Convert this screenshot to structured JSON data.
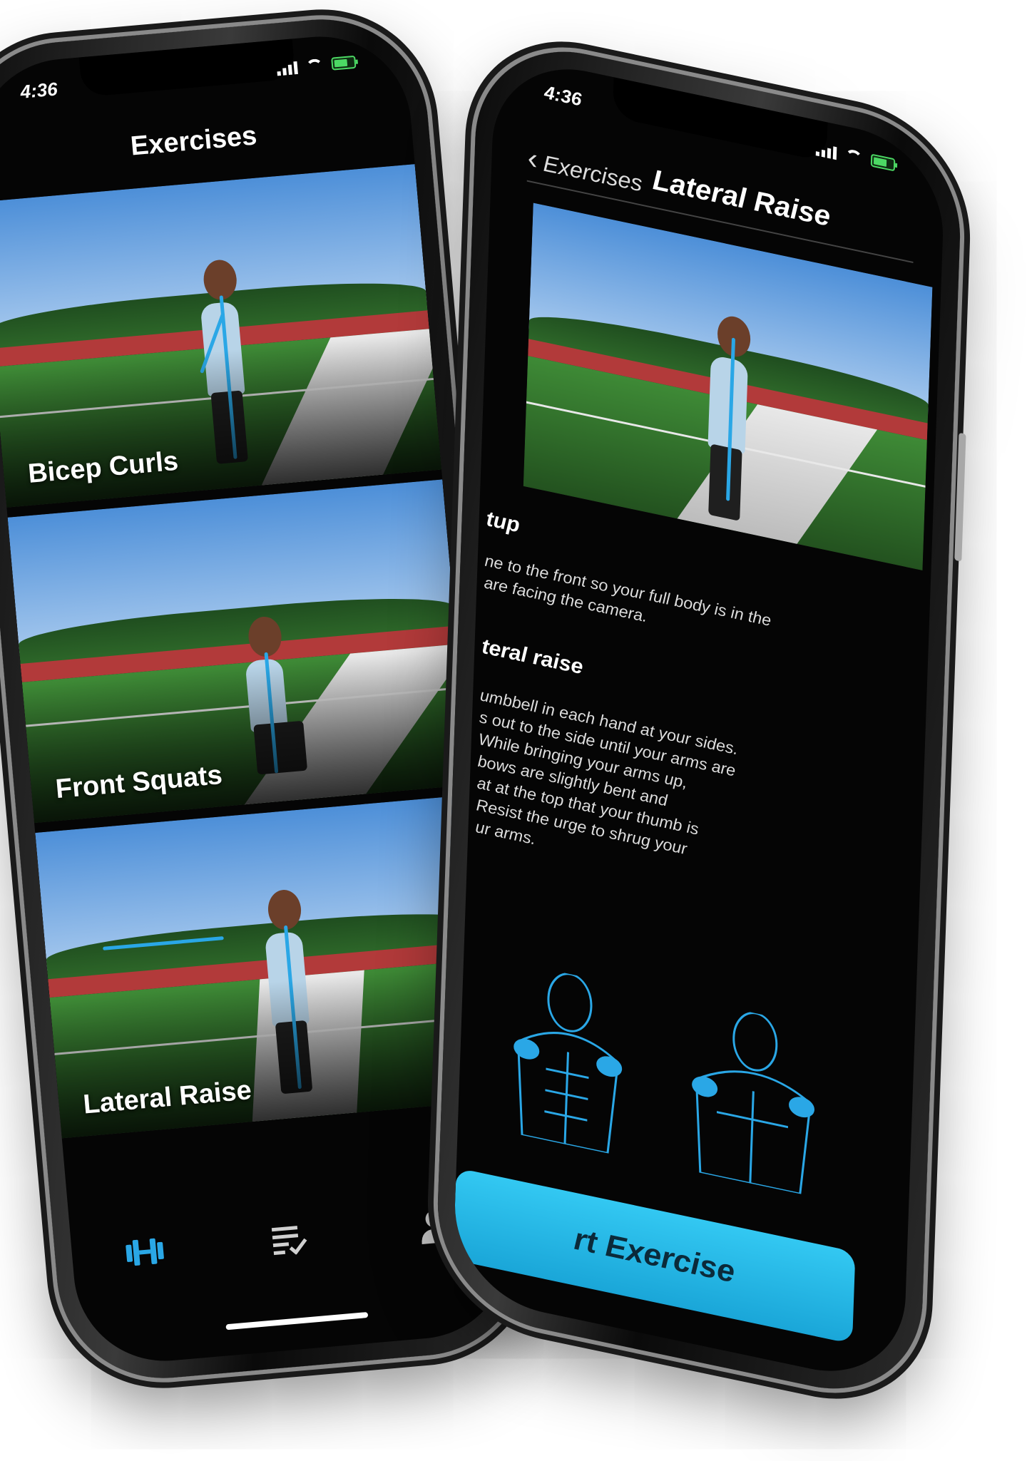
{
  "status": {
    "time": "4:36"
  },
  "left": {
    "title": "Exercises",
    "exercises": [
      {
        "name": "Bicep Curls"
      },
      {
        "name": "Front Squats"
      },
      {
        "name": "Lateral Raise"
      }
    ],
    "tabs": [
      "dumbbell-icon",
      "checklist-icon",
      "profile-icon"
    ],
    "accent": "#2aa7e6"
  },
  "right": {
    "back_label": "Exercises",
    "title": "Lateral Raise",
    "setup_heading": "tup",
    "setup_text_1": "ne to the front so your full body is in the",
    "setup_text_2": "are facing the camera.",
    "how_heading": "teral raise",
    "how_lines": [
      "umbbell in each hand at your sides.",
      "s out to the side until your arms are",
      " While bringing your arms up,",
      "bows are slightly bent and",
      "at at the top that your thumb is",
      "Resist the urge to shrug your",
      "ur arms."
    ],
    "start_button": "rt Exercise",
    "button_color": "#33c8f2"
  }
}
